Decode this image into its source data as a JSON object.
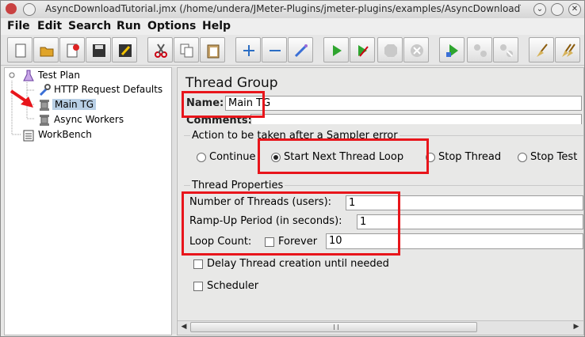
{
  "window": {
    "title": "AsyncDownloadTutorial.jmx (/home/undera/JMeter-Plugins/jmeter-plugins/examples/AsyncDownloadTut...",
    "minimize_glyph": "⌄",
    "close_glyph": "✕"
  },
  "menu": [
    "File",
    "Edit",
    "Search",
    "Run",
    "Options",
    "Help"
  ],
  "toolbar": {
    "buttons": [
      "new",
      "open",
      "close",
      "save",
      "save-as",
      "cut",
      "copy",
      "paste",
      "expand",
      "collapse",
      "toggle",
      "start",
      "start-no-pauses",
      "stop",
      "shutdown",
      "remote-start",
      "remote-stop",
      "remote-shutdown",
      "clear",
      "clear-all"
    ]
  },
  "tree": {
    "items": [
      {
        "label": "Test Plan",
        "icon": "flask-icon",
        "expander": "⊶"
      },
      {
        "label": "HTTP Request Defaults",
        "icon": "wrench-icon"
      },
      {
        "label": "Main TG",
        "icon": "spool-icon"
      },
      {
        "label": "Async Workers",
        "icon": "spool-icon"
      },
      {
        "label": "WorkBench",
        "icon": "clipboard-icon"
      }
    ]
  },
  "panel": {
    "title": "Thread Group",
    "name_label": "Name:",
    "name_value": "Main TG",
    "comments_label": "Comments:",
    "sampler_error": {
      "label": "Action to be taken after a Sampler error",
      "options": [
        "Continue",
        "Start Next Thread Loop",
        "Stop Thread",
        "Stop Test"
      ],
      "selected": "Start Next Thread Loop"
    },
    "thread_props": {
      "label": "Thread Properties",
      "threads_label": "Number of Threads (users):",
      "threads_value": "1",
      "rampup_label": "Ramp-Up Period (in seconds):",
      "rampup_value": "1",
      "loop_label": "Loop Count:",
      "forever_label": "Forever",
      "loop_value": "10"
    },
    "delay_label": "Delay Thread creation until needed",
    "scheduler_label": "Scheduler"
  },
  "scrollbar": {
    "left_arrow": "◀",
    "right_arrow": "▶"
  },
  "colors": {
    "highlight": "#e8151b",
    "selection": "#b8cfe5"
  }
}
